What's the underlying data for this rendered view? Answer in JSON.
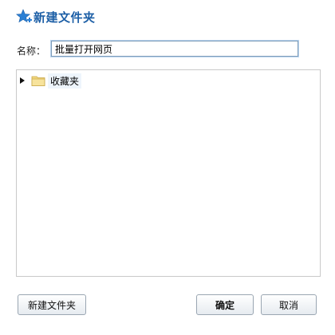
{
  "dialog": {
    "title": "新建文件夹",
    "name_label": "名称：",
    "name_value": "批量打开网页",
    "tree": {
      "items": [
        {
          "label": "收藏夹"
        }
      ]
    },
    "buttons": {
      "new_folder": "新建文件夹",
      "ok": "确定",
      "cancel": "取消"
    }
  },
  "icons": {
    "title": "star-add-icon",
    "expander": "triangle-right-icon",
    "folder": "folder-icon"
  },
  "colors": {
    "title": "#1d5fa6",
    "star": "#2a7fd4",
    "folder": "#f2d77e"
  }
}
